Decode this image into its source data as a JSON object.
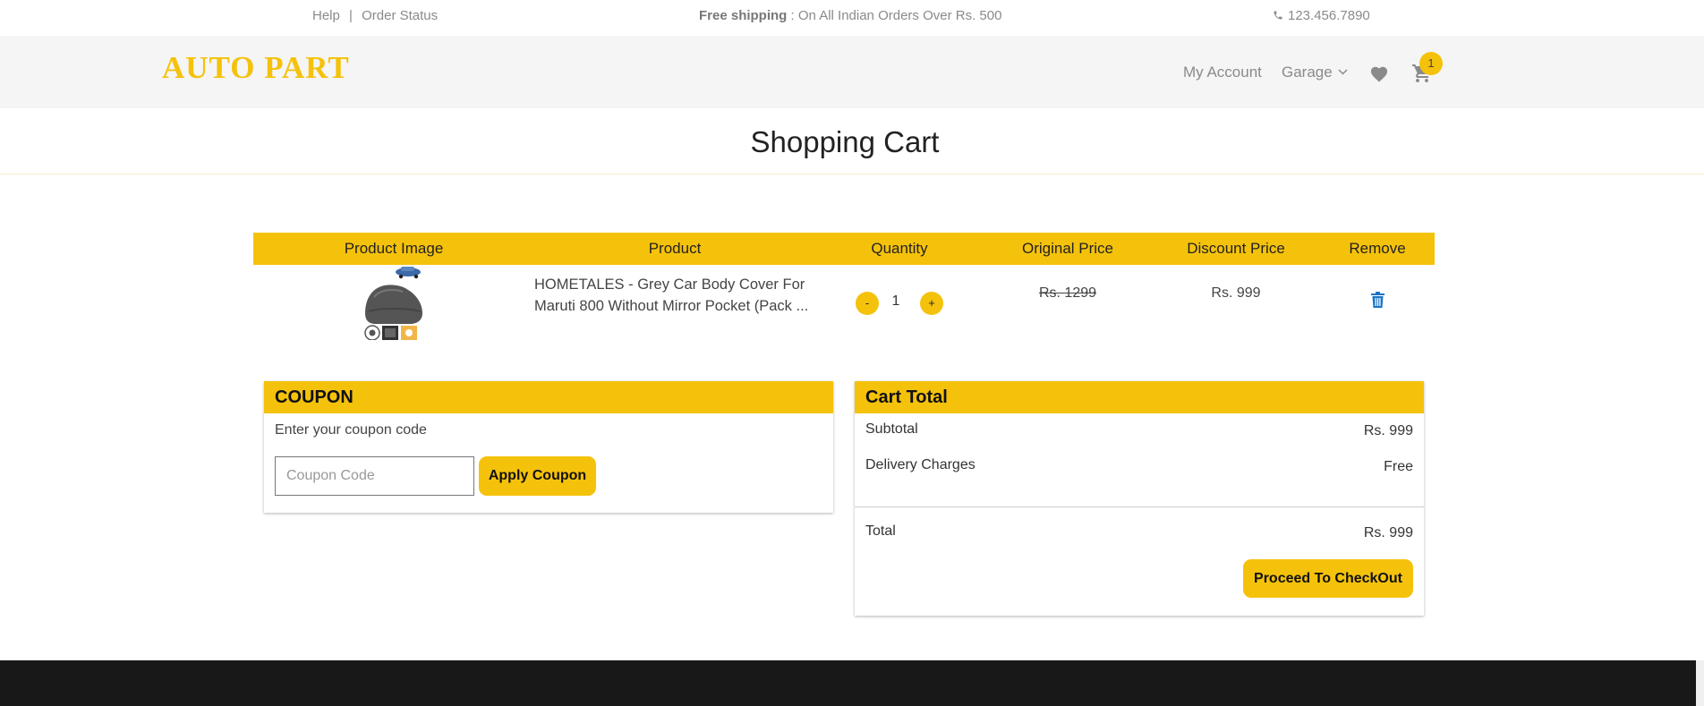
{
  "topbar": {
    "help": "Help",
    "separator": "|",
    "order_status": "Order Status",
    "shipping_bold": "Free shipping",
    "shipping_text": " : On All Indian Orders Over Rs. 500",
    "phone": "123.456.7890",
    "phone_icon": "phone-icon"
  },
  "header": {
    "logo": "AUTO PART",
    "my_account": "My Account",
    "garage": "Garage",
    "garage_icon": "chevron-down-icon",
    "wishlist_icon": "heart-icon",
    "cart_icon": "cart-icon",
    "cart_count": "1"
  },
  "page": {
    "title": "Shopping Cart"
  },
  "table": {
    "headers": [
      "Product Image",
      "Product",
      "Quantity",
      "Original Price",
      "Discount Price",
      "Remove"
    ],
    "rows": [
      {
        "image_icon": "car-cover-product-image",
        "product_line1": "HOMETALES - Grey Car Body Cover For",
        "product_line2": "Maruti 800 Without Mirror Pocket (Pack ...",
        "qty_minus": "-",
        "quantity": "1",
        "qty_plus": "+",
        "original_price": "Rs. 1299",
        "discount_price": "Rs. 999",
        "remove_icon": "trash-icon"
      }
    ]
  },
  "coupon": {
    "title": "COUPON",
    "label": "Enter your coupon code",
    "placeholder": "Coupon Code",
    "apply": "Apply Coupon"
  },
  "totals": {
    "title": "Cart Total",
    "subtotal_label": "Subtotal",
    "subtotal_value": "Rs. 999",
    "delivery_label": "Delivery Charges",
    "delivery_value": "Free",
    "total_label": "Total",
    "total_value": "Rs. 999",
    "checkout": "Proceed To CheckOut"
  },
  "colors": {
    "accent": "#f5c20b",
    "header_bg": "#f5f5f5",
    "footer_bg": "#181818",
    "trash": "#1a73c8"
  }
}
